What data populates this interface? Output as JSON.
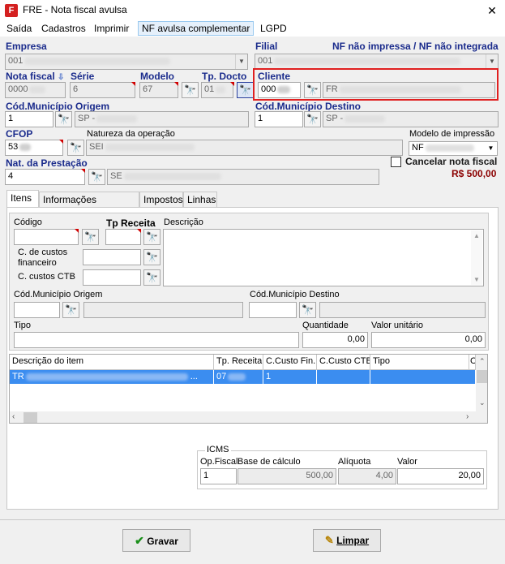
{
  "window": {
    "title": "FRE - Nota fiscal avulsa",
    "app_icon": "F",
    "close_icon": "✕"
  },
  "menu": [
    "Saída",
    "Cadastros",
    "Imprimir",
    "NF avulsa complementar",
    "LGPD"
  ],
  "header": {
    "empresa_label": "Empresa",
    "empresa_value": "001",
    "filial_label": "Filial",
    "filial_value": "001",
    "status_text": "NF não impressa / NF não integrada",
    "nota_fiscal_label": "Nota fiscal",
    "nota_fiscal_value": "0000",
    "serie_label": "Série",
    "serie_value": "6",
    "modelo_label": "Modelo",
    "modelo_value": "67",
    "tp_docto_label": "Tp. Docto",
    "tp_docto_value": "01",
    "cliente_label": "Cliente",
    "cliente_value": "000",
    "cliente_name": "FR",
    "cod_mun_origem_label": "Cód.Município Origem",
    "cod_mun_origem_value": "1",
    "cod_mun_origem_name": "SP -",
    "cod_mun_destino_label": "Cód.Município Destino",
    "cod_mun_destino_value": "1",
    "cod_mun_destino_name": "SP -",
    "cfop_label": "CFOP",
    "cfop_value": "53",
    "natureza_label": "Natureza da operação",
    "natureza_value": "SEI",
    "modelo_impressao_label": "Modelo de impressão",
    "modelo_impressao_value": "NF",
    "nat_prestacao_label": "Nat. da Prestação",
    "nat_prestacao_value": "4",
    "nat_prestacao_name": "SE",
    "cancelar_label": "Cancelar nota fiscal",
    "total_value": "R$ 500,00"
  },
  "tabs": [
    "Itens",
    "Informações adicionais",
    "Impostos",
    "Linhas"
  ],
  "itens": {
    "codigo_label": "Código",
    "tp_receita_label": "Tp Receita",
    "descricao_label": "Descrição",
    "c_custos_fin_label_1": "C. de custos",
    "c_custos_fin_label_2": "financeiro",
    "c_custos_ctb_label": "C. custos CTB",
    "cod_mun_origem_label": "Cód.Município Origem",
    "cod_mun_destino_label": "Cód.Município Destino",
    "tipo_label": "Tipo",
    "quantidade_label": "Quantidade",
    "quantidade_value": "0,00",
    "valor_unitario_label": "Valor unitário",
    "valor_unitario_value": "0,00"
  },
  "grid": {
    "columns": [
      "Descrição do item",
      "Tp. Receita",
      "C.Custo Fin.",
      "C.Custo CTB",
      "Tipo",
      "C"
    ],
    "rows": [
      {
        "descricao": "TR",
        "tp_receita": "07",
        "c_custo_fin": "1",
        "c_custo_ctb": "",
        "tipo": ""
      }
    ]
  },
  "icms": {
    "legend": "ICMS",
    "op_fiscal_label": "Op.Fiscal",
    "op_fiscal_value": "1",
    "base_label": "Base de cálculo",
    "base_value": "500,00",
    "aliquota_label": "Alíquota",
    "aliquota_value": "4,00",
    "valor_label": "Valor",
    "valor_value": "20,00"
  },
  "buttons": {
    "gravar": "Gravar",
    "limpar": "Limpar"
  },
  "colors": {
    "label_blue": "#1a2b8c",
    "total_red": "#8b0000",
    "highlight": "#e02020",
    "selection": "#3b8df0"
  }
}
